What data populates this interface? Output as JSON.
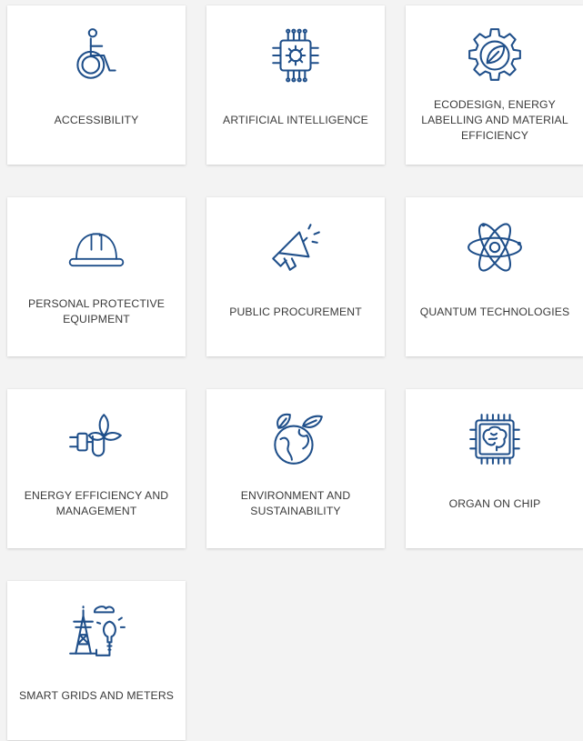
{
  "colors": {
    "background": "#f3f3f3",
    "card": "#ffffff",
    "icon": "#1f4f8a",
    "text": "#3a3a3a"
  },
  "cards": [
    {
      "icon": "wheelchair-icon",
      "label": "ACCESSIBILITY"
    },
    {
      "icon": "ai-chip-icon",
      "label": "ARTIFICIAL INTELLIGENCE"
    },
    {
      "icon": "leaf-gear-icon",
      "label": "ECODESIGN, ENERGY LABELLING AND MATERIAL EFFICIENCY"
    },
    {
      "icon": "hard-hat-icon",
      "label": "PERSONAL PROTECTIVE EQUIPMENT"
    },
    {
      "icon": "megaphone-icon",
      "label": "PUBLIC PROCUREMENT"
    },
    {
      "icon": "atom-icon",
      "label": "QUANTUM TECHNOLOGIES"
    },
    {
      "icon": "plug-plant-icon",
      "label": "ENERGY EFFICIENCY AND MANAGEMENT"
    },
    {
      "icon": "globe-leaves-icon",
      "label": "ENVIRONMENT AND SUSTAINABILITY"
    },
    {
      "icon": "brain-chip-icon",
      "label": "ORGAN ON CHIP"
    },
    {
      "icon": "power-tower-bulb-icon",
      "label": "SMART GRIDS AND METERS"
    }
  ]
}
